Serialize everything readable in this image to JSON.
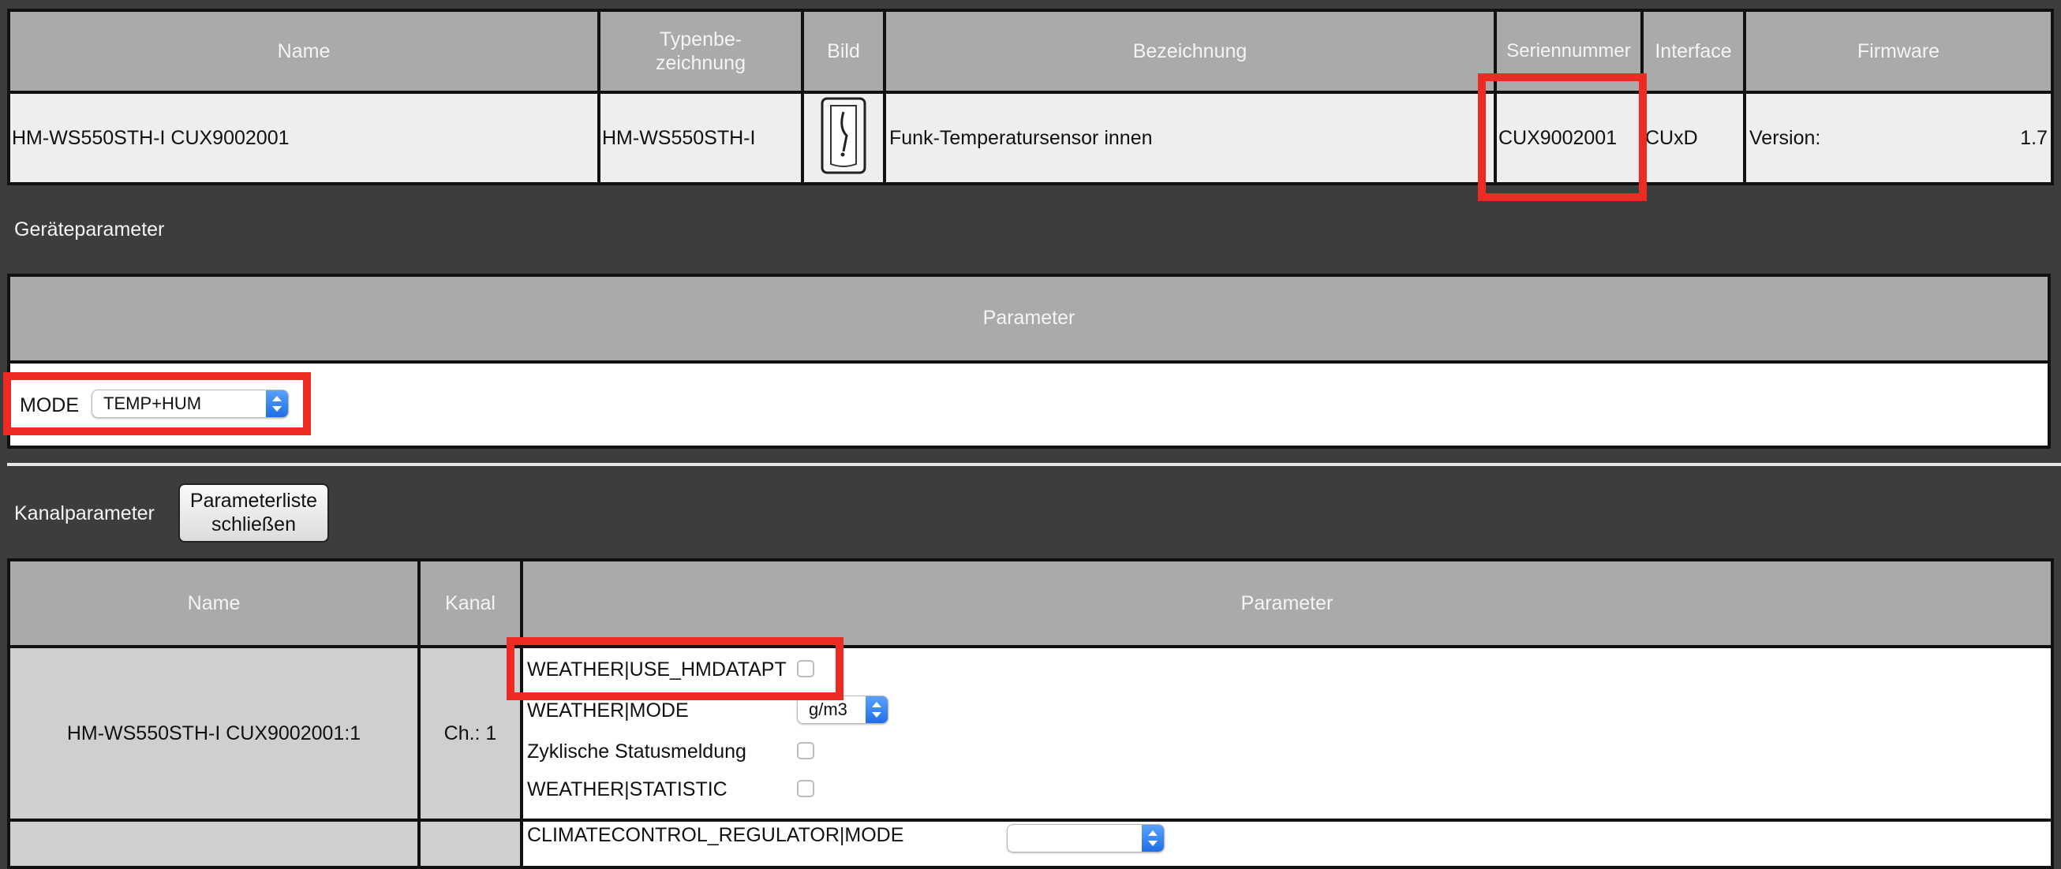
{
  "device_table": {
    "headers": {
      "name": "Name",
      "type": "Typenbe-zeichnung",
      "image": "Bild",
      "description": "Bezeichnung",
      "serial": "Seriennummer",
      "interface": "Interface",
      "firmware": "Firmware"
    },
    "row": {
      "name": "HM-WS550STH-I CUX9002001",
      "type": "HM-WS550STH-I",
      "description": "Funk-Temperatursensor innen",
      "serial": "CUX9002001",
      "interface": "CUxD",
      "firmware_label": "Version:",
      "firmware_value": "1.7"
    }
  },
  "device_params": {
    "section_label": "Geräteparameter",
    "header": "Parameter",
    "mode_label": "MODE",
    "mode_value": "TEMP+HUM"
  },
  "channel_params": {
    "section_label": "Kanalparameter",
    "close_button": "Parameterliste schließen",
    "headers": {
      "name": "Name",
      "channel": "Kanal",
      "parameter": "Parameter"
    },
    "row": {
      "name": "HM-WS550STH-I CUX9002001:1",
      "channel": "Ch.: 1",
      "params": {
        "use_hmdatapt": "WEATHER|USE_HMDATAPT",
        "mode": "WEATHER|MODE",
        "mode_value": "g/m3",
        "cyclic": "Zyklische Statusmeldung",
        "statistic": "WEATHER|STATISTIC"
      }
    },
    "next_row_partial": "CLIMATECONTROL_REGULATOR|MODE"
  },
  "highlight_color": "#ee2b22"
}
